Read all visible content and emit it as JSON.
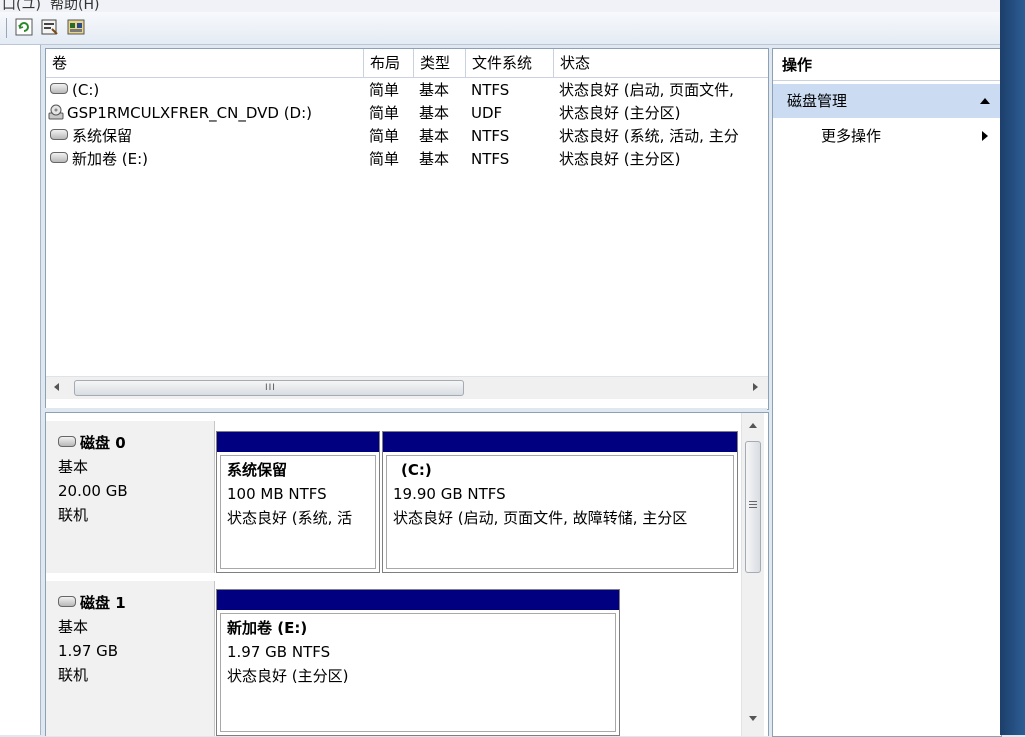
{
  "menu": {
    "items": [
      "口(ユ)",
      "帮助(H)"
    ]
  },
  "toolbar": {
    "buttons": [
      "refresh-icon",
      "properties-icon",
      "disk-settings-icon"
    ]
  },
  "volume_list": {
    "columns": [
      "卷",
      "布局",
      "类型",
      "文件系统",
      "状态"
    ],
    "rows": [
      {
        "icon": "drive-icon",
        "name": "(C:)",
        "layout": "简单",
        "type": "基本",
        "fs": "NTFS",
        "status": "状态良好 (启动, 页面文件,"
      },
      {
        "icon": "cd-drive-icon",
        "name": "GSP1RMCULXFRER_CN_DVD (D:)",
        "layout": "简单",
        "type": "基本",
        "fs": "UDF",
        "status": "状态良好 (主分区)"
      },
      {
        "icon": "drive-icon",
        "name": "系统保留",
        "layout": "简单",
        "type": "基本",
        "fs": "NTFS",
        "status": "状态良好 (系统, 活动, 主分"
      },
      {
        "icon": "drive-icon",
        "name": "新加卷 (E:)",
        "layout": "简单",
        "type": "基本",
        "fs": "NTFS",
        "status": "状态良好 (主分区)"
      }
    ],
    "scroll_grip": "III"
  },
  "disks": [
    {
      "name": "磁盘 0",
      "type": "基本",
      "size": "20.00 GB",
      "state": "联机",
      "partitions": [
        {
          "name": "系统保留",
          "size": "100 MB NTFS",
          "status": "状态良好 (系统, 活"
        },
        {
          "name": "(C:)",
          "size": "19.90 GB NTFS",
          "status": "状态良好 (启动, 页面文件, 故障转储, 主分区"
        }
      ]
    },
    {
      "name": "磁盘 1",
      "type": "基本",
      "size": "1.97 GB",
      "state": "联机",
      "partitions": [
        {
          "name": "新加卷  (E:)",
          "size": "1.97 GB NTFS",
          "status": "状态良好 (主分区)"
        }
      ]
    }
  ],
  "actions": {
    "title": "操作",
    "section": "磁盘管理",
    "more": "更多操作"
  },
  "colors": {
    "partition_bar": "#000080",
    "actions_selected": "#cbdcf2"
  }
}
